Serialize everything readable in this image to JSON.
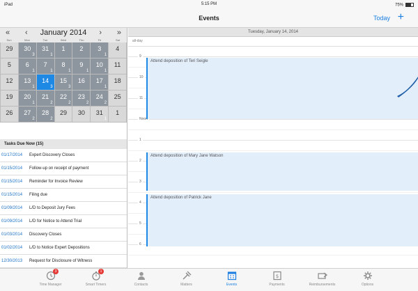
{
  "status": {
    "device": "iPad",
    "time": "5:15 PM",
    "battery": "75%"
  },
  "nav": {
    "title": "Events",
    "today_label": "Today",
    "add_label": "+"
  },
  "calendar": {
    "month_label": "January 2014",
    "prev_year": "«",
    "prev_month": "‹",
    "next_month": "›",
    "next_year": "»",
    "dow": [
      "Sun",
      "Mon",
      "Tue",
      "Wed",
      "Thu",
      "Fri",
      "Sat"
    ],
    "cells": [
      {
        "d": "29",
        "c": "",
        "cur": false
      },
      {
        "d": "30",
        "c": "3",
        "cur": true
      },
      {
        "d": "31",
        "c": "1",
        "cur": true
      },
      {
        "d": "1",
        "c": "",
        "cur": true
      },
      {
        "d": "2",
        "c": "",
        "cur": true
      },
      {
        "d": "3",
        "c": "1",
        "cur": true
      },
      {
        "d": "4",
        "c": "",
        "cur": false
      },
      {
        "d": "5",
        "c": "",
        "cur": false
      },
      {
        "d": "6",
        "c": "1",
        "cur": true
      },
      {
        "d": "7",
        "c": "1",
        "cur": true
      },
      {
        "d": "8",
        "c": "1",
        "cur": true
      },
      {
        "d": "9",
        "c": "1",
        "cur": true
      },
      {
        "d": "10",
        "c": "1",
        "cur": true
      },
      {
        "d": "11",
        "c": "",
        "cur": false
      },
      {
        "d": "12",
        "c": "",
        "cur": false
      },
      {
        "d": "13",
        "c": "1",
        "cur": true
      },
      {
        "d": "14",
        "c": "3",
        "cur": true,
        "sel": true
      },
      {
        "d": "15",
        "c": "3",
        "cur": true
      },
      {
        "d": "16",
        "c": "",
        "cur": true
      },
      {
        "d": "17",
        "c": "1",
        "cur": true
      },
      {
        "d": "18",
        "c": "",
        "cur": false
      },
      {
        "d": "19",
        "c": "",
        "cur": false
      },
      {
        "d": "20",
        "c": "1",
        "cur": true
      },
      {
        "d": "21",
        "c": "2",
        "cur": true
      },
      {
        "d": "22",
        "c": "2",
        "cur": true
      },
      {
        "d": "23",
        "c": "2",
        "cur": true
      },
      {
        "d": "24",
        "c": "2",
        "cur": true
      },
      {
        "d": "25",
        "c": "",
        "cur": false
      },
      {
        "d": "26",
        "c": "",
        "cur": false
      },
      {
        "d": "27",
        "c": "2",
        "cur": true
      },
      {
        "d": "28",
        "c": "2",
        "cur": true
      },
      {
        "d": "29",
        "c": "",
        "cur": false
      },
      {
        "d": "30",
        "c": "",
        "cur": false
      },
      {
        "d": "31",
        "c": "1",
        "cur": false
      },
      {
        "d": "1",
        "c": "",
        "cur": false
      }
    ]
  },
  "tasks": {
    "header": "Tasks Due Now (15)",
    "items": [
      {
        "date": "01/17/2014",
        "name": "Expert Discovery Closes"
      },
      {
        "date": "01/15/2014",
        "name": "Follow-up on receipt of payment"
      },
      {
        "date": "01/15/2014",
        "name": "Reminder for Invoice Review"
      },
      {
        "date": "01/15/2014",
        "name": "Filing due"
      },
      {
        "date": "01/09/2014",
        "name": "L/D to Deposit Jury Fees"
      },
      {
        "date": "01/09/2014",
        "name": "L/D for Notice to Attend Trial"
      },
      {
        "date": "01/03/2014",
        "name": "Discovery Closes"
      },
      {
        "date": "01/02/2014",
        "name": "L/D to Notice Expert Depositions"
      },
      {
        "date": "12/30/2013",
        "name": "Request for Disclosure of Witness"
      }
    ]
  },
  "day": {
    "header": "Tuesday, January 14, 2014",
    "allday_label": "all-day",
    "hours": [
      "9",
      "10",
      "11",
      "Noon",
      "1",
      "2",
      "3",
      "4",
      "5",
      "6"
    ],
    "events": [
      {
        "title": "Attend deposition of Teri Seigle"
      },
      {
        "title": "Attend deposition of Mary Jane Watson"
      },
      {
        "title": "Attend deposition of Patrick Jane"
      }
    ]
  },
  "tabbar": {
    "items": [
      {
        "label": "Time Manager",
        "badge": "3"
      },
      {
        "label": "Smart Timers",
        "badge": "1"
      },
      {
        "label": "Contacts",
        "badge": ""
      },
      {
        "label": "Matters",
        "badge": ""
      },
      {
        "label": "Events",
        "badge": "",
        "active": true
      },
      {
        "label": "Payments",
        "badge": ""
      },
      {
        "label": "Reimbursements",
        "badge": ""
      },
      {
        "label": "Options",
        "badge": ""
      }
    ]
  }
}
